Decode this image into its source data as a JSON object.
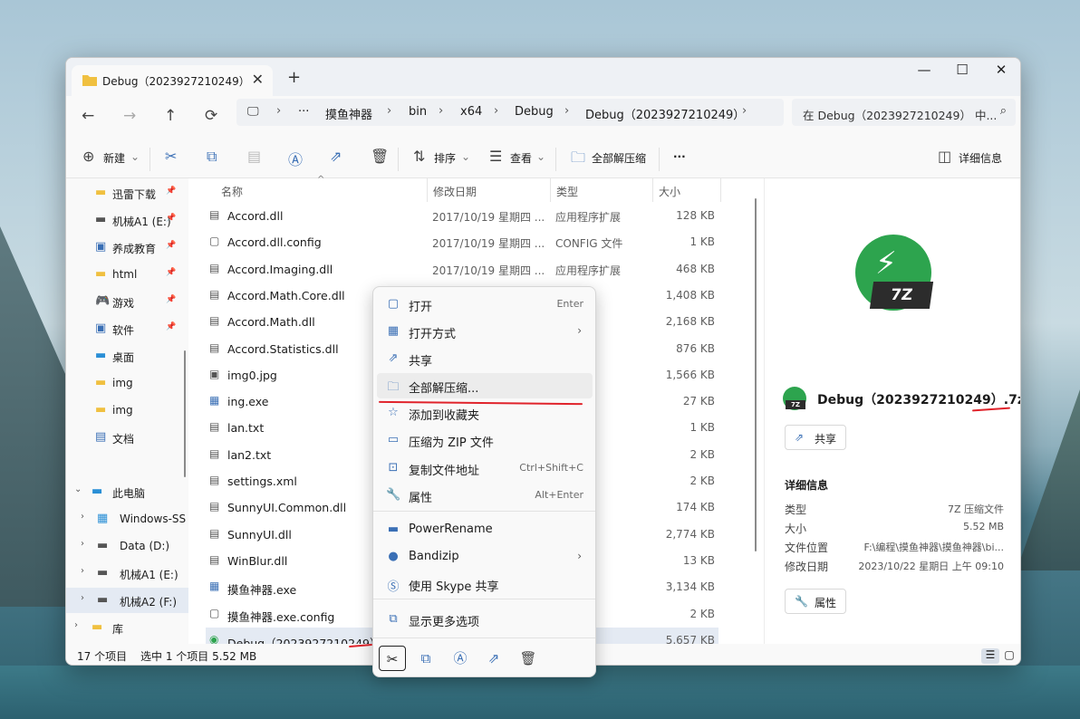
{
  "window": {
    "tab_title": "Debug（2023927210249）",
    "tab_close": "✕",
    "new_tab": "+",
    "minimize": "—",
    "maximize": "☐",
    "close": "✕"
  },
  "nav": {
    "back": "←",
    "forward": "→",
    "up": "↑",
    "refresh": "⟳",
    "breadcrumb": [
      "···",
      "摸鱼神器",
      "bin",
      "x64",
      "Debug",
      "Debug（2023927210249）"
    ],
    "search_placeholder": "在 Debug（2023927210249） 中..."
  },
  "toolbar": {
    "new_label": "新建",
    "sort_label": "排序",
    "view_label": "查看",
    "extract_all_label": "全部解压缩",
    "more_label": "···",
    "details_label": "详细信息"
  },
  "sidebar": {
    "items": [
      {
        "label": "迅雷下载",
        "icon": "folder-icon"
      },
      {
        "label": "机械A1 (E:)",
        "icon": "drive-icon"
      },
      {
        "label": "养成教育",
        "icon": "image-folder-icon"
      },
      {
        "label": "html",
        "icon": "folder-icon"
      },
      {
        "label": "游戏",
        "icon": "gamepad-icon"
      },
      {
        "label": "软件",
        "icon": "image-folder-icon"
      },
      {
        "label": "桌面",
        "icon": "desktop-icon"
      },
      {
        "label": "img",
        "icon": "folder-icon"
      },
      {
        "label": "img",
        "icon": "folder-icon"
      },
      {
        "label": "文档",
        "icon": "document-icon"
      }
    ],
    "this_pc": "此电脑",
    "drives": [
      "Windows-SS",
      "Data (D:)",
      "机械A1 (E:)",
      "机械A2 (F:)"
    ],
    "library": "库"
  },
  "columns": {
    "name": "名称",
    "date": "修改日期",
    "type": "类型",
    "size": "大小"
  },
  "files": [
    {
      "name": "Accord.dll",
      "date": "2017/10/19 星期四 ...",
      "type": "应用程序扩展",
      "size": "128 KB"
    },
    {
      "name": "Accord.dll.config",
      "date": "2017/10/19 星期四 ...",
      "type": "CONFIG 文件",
      "size": "1 KB"
    },
    {
      "name": "Accord.Imaging.dll",
      "date": "2017/10/19 星期四 ...",
      "type": "应用程序扩展",
      "size": "468 KB"
    },
    {
      "name": "Accord.Math.Core.dll",
      "date": "",
      "type": "扩展",
      "size": "1,408 KB"
    },
    {
      "name": "Accord.Math.dll",
      "date": "",
      "type": "扩展",
      "size": "2,168 KB"
    },
    {
      "name": "Accord.Statistics.dll",
      "date": "",
      "type": "扩展",
      "size": "876 KB"
    },
    {
      "name": "img0.jpg",
      "date": "",
      "type": "",
      "size": "1,566 KB"
    },
    {
      "name": "ing.exe",
      "date": "",
      "type": "",
      "size": "27 KB"
    },
    {
      "name": "lan.txt",
      "date": "",
      "type": "",
      "size": "1 KB"
    },
    {
      "name": "lan2.txt",
      "date": "",
      "type": "",
      "size": "2 KB"
    },
    {
      "name": "settings.xml",
      "date": "",
      "type": "件",
      "size": "2 KB"
    },
    {
      "name": "SunnyUI.Common.dll",
      "date": "",
      "type": "扩展",
      "size": "174 KB"
    },
    {
      "name": "SunnyUI.dll",
      "date": "",
      "type": "扩展",
      "size": "2,774 KB"
    },
    {
      "name": "WinBlur.dll",
      "date": "",
      "type": "扩展",
      "size": "13 KB"
    },
    {
      "name": "摸鱼神器.exe",
      "date": "",
      "type": "",
      "size": "3,134 KB"
    },
    {
      "name": "摸鱼神器.exe.config",
      "date": "",
      "type": "文件",
      "size": "2 KB"
    },
    {
      "name": "Debug（2023927210249）.7z",
      "date": "",
      "type": "文件",
      "size": "5,657 KB"
    }
  ],
  "context_menu": {
    "items": [
      {
        "label": "打开",
        "shortcut": "Enter",
        "icon": "open-icon"
      },
      {
        "label": "打开方式",
        "shortcut": "",
        "icon": "open-with-icon",
        "submenu": true
      },
      {
        "label": "共享",
        "shortcut": "",
        "icon": "share-icon"
      },
      {
        "label": "全部解压缩...",
        "shortcut": "",
        "icon": "extract-icon"
      },
      {
        "label": "添加到收藏夹",
        "shortcut": "",
        "icon": "star-icon"
      },
      {
        "label": "压缩为 ZIP 文件",
        "shortcut": "",
        "icon": "zip-icon"
      },
      {
        "label": "复制文件地址",
        "shortcut": "Ctrl+Shift+C",
        "icon": "copy-path-icon"
      },
      {
        "label": "属性",
        "shortcut": "Alt+Enter",
        "icon": "wrench-icon"
      },
      {
        "label": "PowerRename",
        "shortcut": "",
        "icon": "powerrename-icon"
      },
      {
        "label": "Bandizip",
        "shortcut": "",
        "icon": "bandizip-icon",
        "submenu": true
      },
      {
        "label": "使用 Skype 共享",
        "shortcut": "",
        "icon": "skype-icon"
      },
      {
        "label": "显示更多选项",
        "shortcut": "",
        "icon": "more-options-icon"
      }
    ]
  },
  "details": {
    "badge_text": "7Z",
    "file_name": "Debug（2023927210249）.7z",
    "share_label": "共享",
    "section_title": "详细信息",
    "props": [
      {
        "key": "类型",
        "value": "7Z 压缩文件"
      },
      {
        "key": "大小",
        "value": "5.52 MB"
      },
      {
        "key": "文件位置",
        "value": "F:\\编程\\摸鱼神器\\摸鱼神器\\bi..."
      },
      {
        "key": "修改日期",
        "value": "2023/10/22 星期日 上午 09:10"
      }
    ],
    "properties_label": "属性"
  },
  "status": {
    "count": "17 个项目",
    "selected": "选中 1 个项目  5.52 MB"
  },
  "colors": {
    "accent": "#3a6fb5",
    "annotation": "#e0232b",
    "archive_green": "#2da44e"
  }
}
